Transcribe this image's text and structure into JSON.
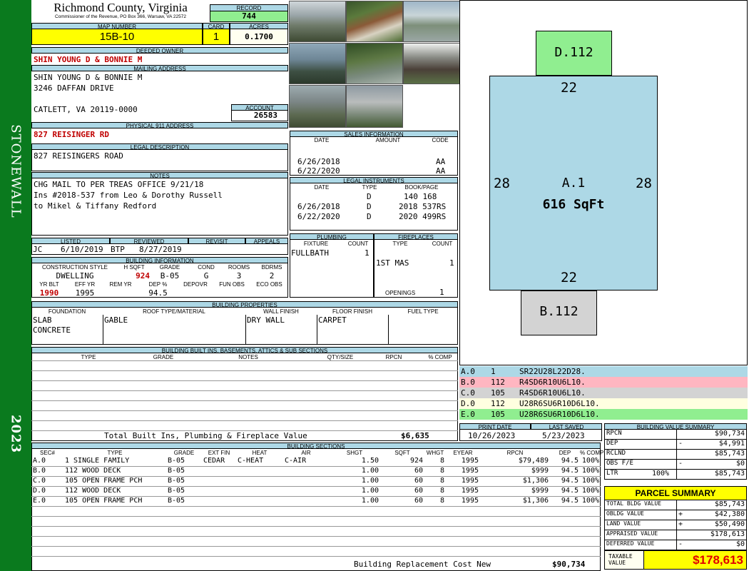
{
  "sidebar": {
    "district": "STONEWALL",
    "year": "2023"
  },
  "header": {
    "county": "Richmond County, Virginia",
    "commissioner": "Commissioner of the Revenue, PO Box 366, Warsaw, VA 22572",
    "record_label": "RECORD",
    "record": "744",
    "map_label": "MAP NUMBER",
    "map_number": "15B-10",
    "card_label": "CARD",
    "card": "1",
    "acres_label": "ACRES",
    "acres": "0.1700"
  },
  "owner": {
    "deeded_label": "DEEDED OWNER",
    "deeded": "SHIN YOUNG D & BONNIE M",
    "mailing_label": "MAILING ADDRESS",
    "mail1": "SHIN YOUNG D & BONNIE M",
    "mail2": "3246 DAFFAN DRIVE",
    "mail3": "CATLETT, VA 20119-0000",
    "account_label": "ACCOUNT",
    "account": "26583",
    "physical_label": "PHYSICAL 911 ADDRESS",
    "physical": "827 REISINGER RD"
  },
  "legal": {
    "label": "LEGAL DESCRIPTION",
    "text": "827 REISINGERS ROAD"
  },
  "notes": {
    "label": "NOTES",
    "line1": "CHG MAIL TO PER TREAS OFFICE 9/21/18",
    "line2": "Ins #2018-537 from Leo & Dorothy Russell",
    "line3": "to Mikel & Tiffany Redford"
  },
  "review": {
    "listed_label": "LISTED",
    "reviewed_label": "REVIEWED",
    "revisit_label": "REVISIT",
    "appeals_label": "APPEALS",
    "listed_by": "JC",
    "listed_date": "6/10/2019",
    "reviewed_by": "BTP",
    "reviewed_date": "8/27/2019"
  },
  "building_info": {
    "label": "BUILDING INFORMATION",
    "h1": [
      "CONSTRUCTION STYLE",
      "H SQFT",
      "GRADE",
      "COND",
      "ROOMS",
      "BDRMS"
    ],
    "v1": [
      "DWELLING",
      "924",
      "B-05",
      "G",
      "3",
      "2"
    ],
    "h2": [
      "YR BLT",
      "EFF YR",
      "REM YR",
      "DEP %",
      "DEPOVR",
      "FUN OBS",
      "ECO OBS"
    ],
    "v2": [
      "1990",
      "1995",
      "",
      "94.5",
      "",
      "",
      ""
    ]
  },
  "sales": {
    "label": "SALES INFORMATION",
    "cols": [
      "DATE",
      "AMOUNT",
      "CODE"
    ],
    "rows": [
      [
        "6/26/2018",
        "AA"
      ],
      [
        "6/22/2020",
        "AA"
      ]
    ]
  },
  "instruments": {
    "label": "LEGAL INSTRUMENTS",
    "cols": [
      "DATE",
      "TYPE",
      "BOOK/PAGE"
    ],
    "rows": [
      [
        "",
        "D",
        "140 168"
      ],
      [
        "6/26/2018",
        "D",
        "2018 537RS"
      ],
      [
        "6/22/2020",
        "D",
        "2020 499RS"
      ]
    ]
  },
  "plumbing": {
    "label": "PLUMBING",
    "cols": [
      "FIXTURE",
      "COUNT"
    ],
    "rows": [
      [
        "FULLBATH",
        "1"
      ]
    ]
  },
  "fireplaces": {
    "label": "FIREPLACES",
    "cols": [
      "TYPE",
      "COUNT"
    ],
    "rows": [
      [
        "1ST MAS",
        "1"
      ]
    ],
    "openings_label": "OPENINGS",
    "openings": "1"
  },
  "properties": {
    "label": "BUILDING PROPERTIES",
    "cols": [
      "FOUNDATION",
      "ROOF TYPE/MATERIAL",
      "WALL FINISH",
      "FLOOR FINISH",
      "FUEL TYPE"
    ],
    "foundation1": "SLAB",
    "foundation2": "CONCRETE",
    "roof": "GABLE",
    "wall": "DRY WALL",
    "floor": "CARPET"
  },
  "builtins": {
    "label": "BUILDING BUILT INS, BASEMENTS, ATTICS & SUB SECTIONS",
    "cols": [
      "TYPE",
      "GRADE",
      "NOTES",
      "QTY/SIZE",
      "RPCN",
      "% COMP"
    ],
    "total_label": "Total Built Ins, Plumbing & Fireplace Value",
    "total": "$6,635"
  },
  "sections": {
    "label": "BUILDING SECTIONS",
    "cols": [
      "SEC#",
      "TYPE",
      "GRADE",
      "EXT FIN",
      "HEAT",
      "AIR",
      "SHGT",
      "SQFT",
      "WHGT",
      "EYEAR",
      "RPCN",
      "DEP",
      "% COMP"
    ],
    "rows": [
      [
        "A.0",
        "1 SINGLE FAMILY",
        "B-05",
        "CEDAR",
        "C-HEAT",
        "C-AIR",
        "1.50",
        "924",
        "8",
        "1995",
        "$79,489",
        "94.5",
        "100%"
      ],
      [
        "B.0",
        "112 WOOD DECK",
        "B-05",
        "",
        "",
        "",
        "1.00",
        "60",
        "8",
        "1995",
        "$999",
        "94.5",
        "100%"
      ],
      [
        "C.0",
        "105 OPEN FRAME PCH",
        "B-05",
        "",
        "",
        "",
        "1.00",
        "60",
        "8",
        "1995",
        "$1,306",
        "94.5",
        "100%"
      ],
      [
        "D.0",
        "112 WOOD DECK",
        "B-05",
        "",
        "",
        "",
        "1.00",
        "60",
        "8",
        "1995",
        "$999",
        "94.5",
        "100%"
      ],
      [
        "E.0",
        "105 OPEN FRAME PCH",
        "B-05",
        "",
        "",
        "",
        "1.00",
        "60",
        "8",
        "1995",
        "$1,306",
        "94.5",
        "100%"
      ]
    ],
    "total_label": "Building Replacement Cost New",
    "total": "$90,734"
  },
  "sketch": {
    "d_label": "D.112",
    "b_label": "B.112",
    "a_label": "A.1",
    "a_area": "616 SqFt",
    "top": "22",
    "bottom": "22",
    "left": "28",
    "right": "28"
  },
  "vectors": [
    {
      "sec": "A.0",
      "code": "1",
      "vec": "SR22U28L22D28.",
      "color": "#add8e6"
    },
    {
      "sec": "B.0",
      "code": "112",
      "vec": "R4SD6R10U6L10.",
      "color": "#ffb6c1"
    },
    {
      "sec": "C.0",
      "code": "105",
      "vec": "R4SD6R10U6L10.",
      "color": "#d3d3d3"
    },
    {
      "sec": "D.0",
      "code": "112",
      "vec": "U28R6SU6R10D6L10.",
      "color": "#ffffe0"
    },
    {
      "sec": "E.0",
      "code": "105",
      "vec": "U28R6SU6R10D6L10.",
      "color": "#90ee90"
    }
  ],
  "dates": {
    "print_label": "PRINT DATE",
    "print": "10/26/2023",
    "saved_label": "LAST SAVED",
    "saved": "5/23/2023"
  },
  "bvs": {
    "label": "BUILDING VALUE SUMMARY",
    "rows": [
      [
        "RPCN",
        "",
        "$90,734"
      ],
      [
        "DEP",
        "-",
        "$4,991"
      ],
      [
        "RCLND",
        "",
        "$85,743"
      ],
      [
        "OBS F/E",
        "-",
        "$0"
      ]
    ],
    "ltr_label": "LTR",
    "ltr_pct": "100%",
    "ltr": "$85,743"
  },
  "parcel": {
    "label": "PARCEL SUMMARY",
    "rows": [
      [
        "TOTAL BLDG VALUE",
        "",
        "$85,743"
      ],
      [
        "OBLDG VALUE",
        "+",
        "$42,380"
      ],
      [
        "LAND VALUE",
        "+",
        "$50,490"
      ],
      [
        "APPRAISED VALUE",
        "",
        "$178,613"
      ],
      [
        "DEFERRED VALUE",
        "-",
        "$0"
      ]
    ],
    "taxable_label1": "TAXABLE",
    "taxable_label2": "VALUE",
    "taxable": "$178,613"
  }
}
